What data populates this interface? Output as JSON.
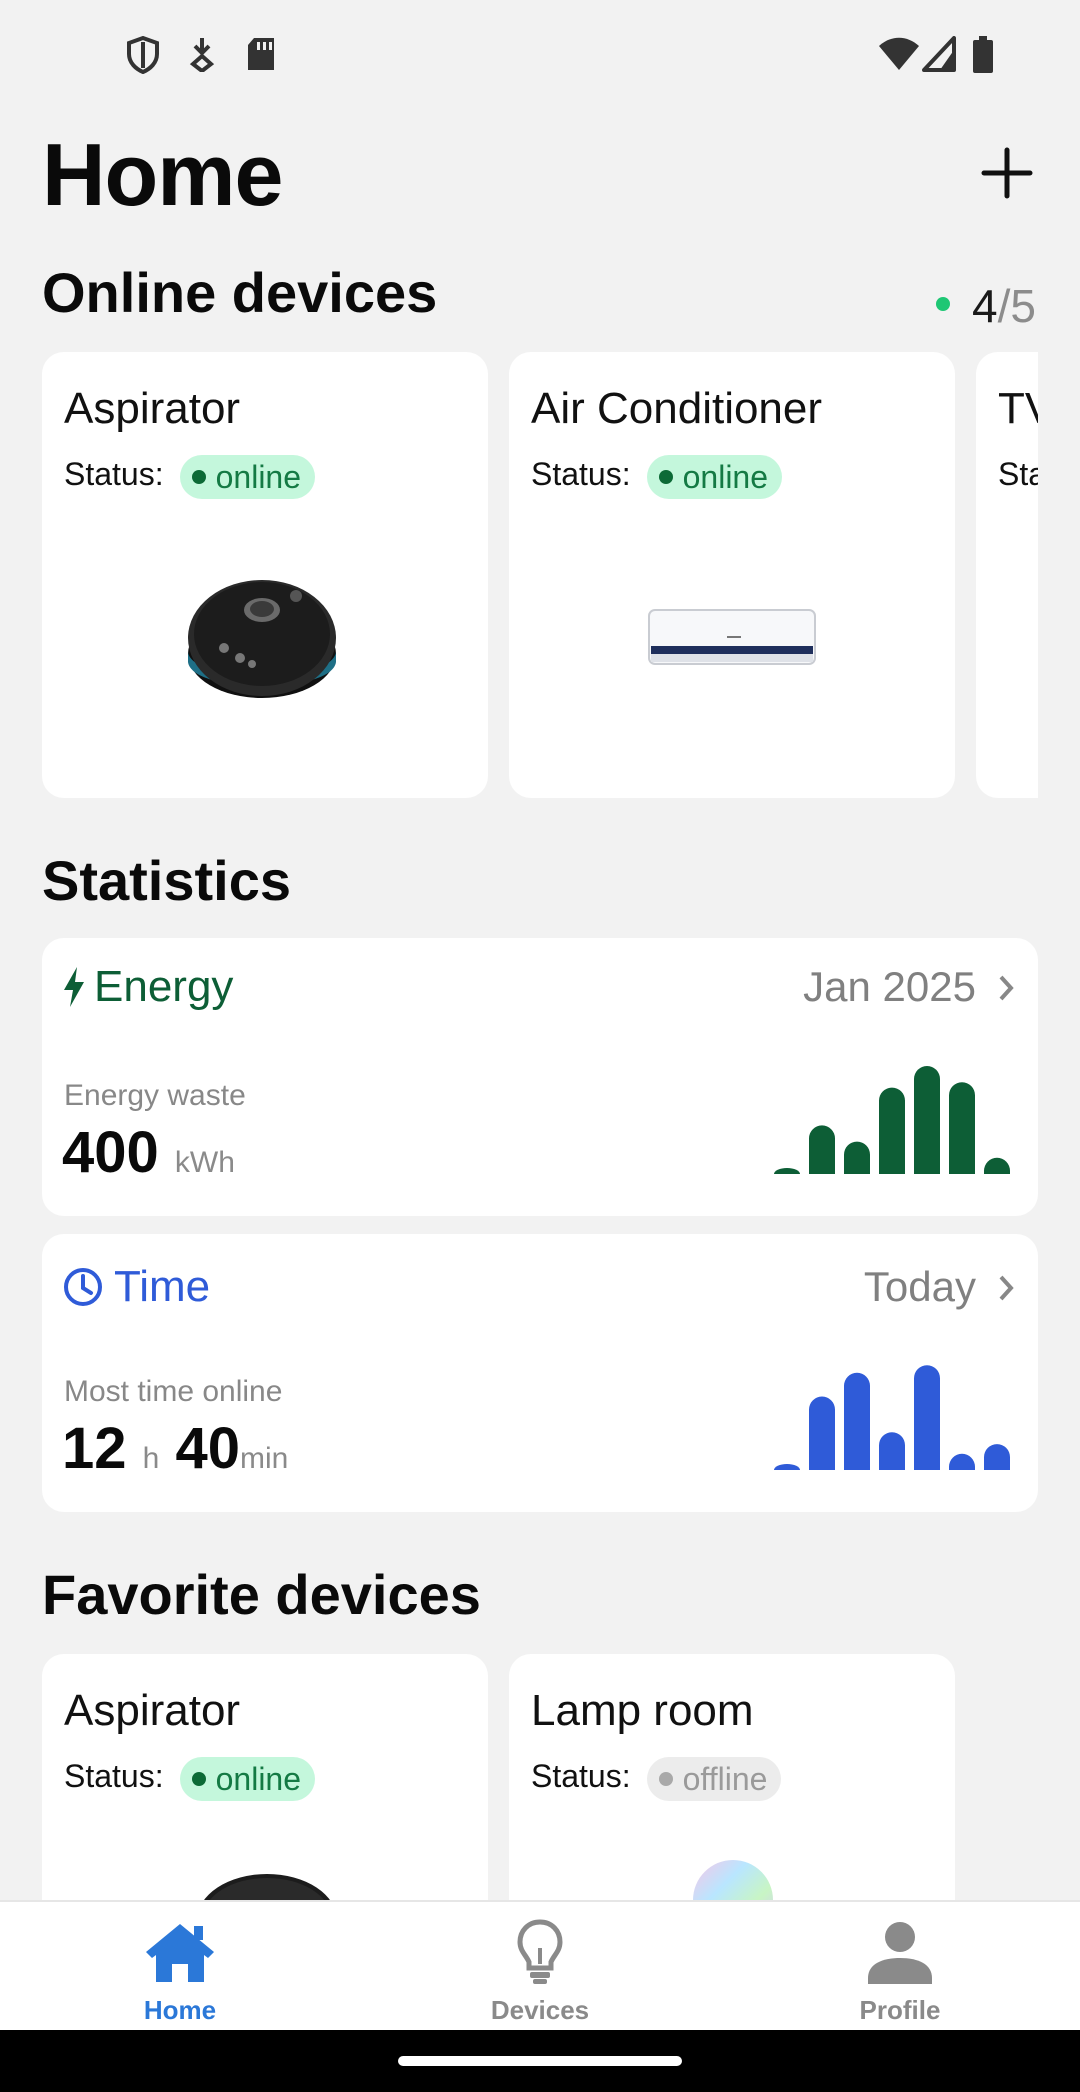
{
  "header": {
    "title": "Home"
  },
  "online_devices": {
    "title": "Online devices",
    "count_online": "4",
    "count_sep": "/",
    "count_total": "5",
    "status_label": "Status:",
    "cards": [
      {
        "name": "Aspirator",
        "status": "online"
      },
      {
        "name": "Air Conditioner",
        "status": "online"
      },
      {
        "name": "TV",
        "status_partial": "Sta"
      }
    ]
  },
  "statistics": {
    "title": "Statistics",
    "energy": {
      "label": "Energy",
      "period": "Jan 2025",
      "sub": "Energy waste",
      "value": "400",
      "unit": "kWh",
      "color": "#0d5e36",
      "bars": [
        2,
        45,
        30,
        80,
        100,
        85,
        15
      ]
    },
    "time": {
      "label": "Time",
      "period": "Today",
      "sub": "Most time online",
      "hours": "12",
      "hours_unit": "h",
      "minutes": "40",
      "minutes_unit": "min",
      "color": "#2f5bd8",
      "bars": [
        3,
        68,
        90,
        35,
        97,
        15,
        24
      ]
    }
  },
  "favorite_devices": {
    "title": "Favorite devices",
    "status_label": "Status:",
    "cards": [
      {
        "name": "Aspirator",
        "status": "online"
      },
      {
        "name": "Lamp room",
        "status": "offline"
      }
    ]
  },
  "bottom_nav": {
    "active_color": "#2b78d8",
    "inactive_color": "#8a8a8a",
    "items": [
      {
        "label": "Home",
        "icon": "home-icon",
        "active": true
      },
      {
        "label": "Devices",
        "icon": "lightbulb-icon",
        "active": false
      },
      {
        "label": "Profile",
        "icon": "person-icon",
        "active": false
      }
    ]
  }
}
